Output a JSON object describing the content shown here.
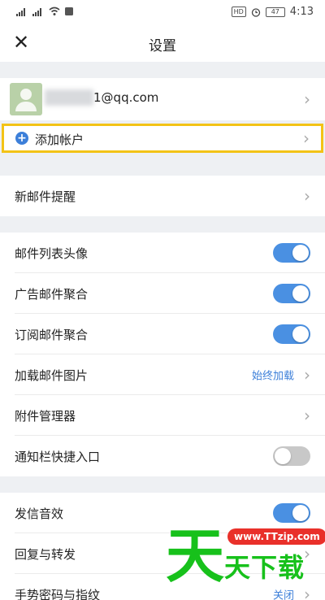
{
  "status_bar": {
    "time": "4:13",
    "battery": "47",
    "hd": "HD"
  },
  "header": {
    "title": "设置",
    "close_icon": "close-icon"
  },
  "account": {
    "email": "1@qq.com"
  },
  "add_account": {
    "label": "添加帐户"
  },
  "sections": {
    "new_mail": {
      "label": "新邮件提醒"
    },
    "list_avatar": {
      "label": "邮件列表头像",
      "enabled": true
    },
    "ad_merge": {
      "label": "广告邮件聚合",
      "enabled": true
    },
    "sub_merge": {
      "label": "订阅邮件聚合",
      "enabled": true
    },
    "load_images": {
      "label": "加载邮件图片",
      "value": "始终加载"
    },
    "attachments": {
      "label": "附件管理器"
    },
    "notify_shortcut": {
      "label": "通知栏快捷入口",
      "enabled": false
    },
    "send_sound": {
      "label": "发信音效",
      "enabled": true
    },
    "reply_forward": {
      "label": "回复与转发"
    },
    "gesture_fingerprint": {
      "label": "手势密码与指纹",
      "value": "关闭"
    }
  },
  "watermark": {
    "url": "www.TTzip.com",
    "big": "天",
    "small": "天下载"
  },
  "colors": {
    "accent": "#3c7fd9",
    "toggle_on": "#4a90e2",
    "toggle_off": "#c8c8c8",
    "highlight": "#f3c316",
    "watermark_green": "#17c11b",
    "watermark_red": "#e9302a"
  }
}
